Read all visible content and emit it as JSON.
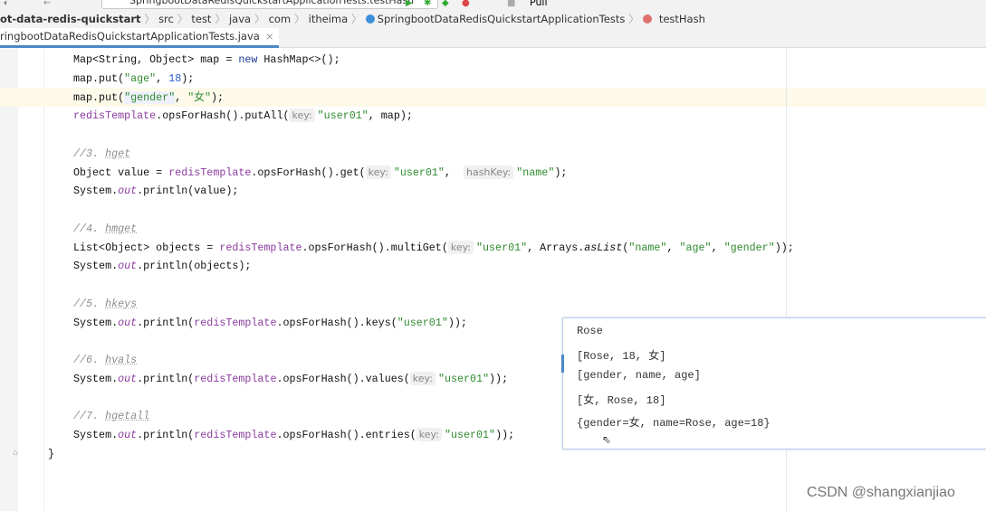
{
  "toolbar": {
    "run_config": "SpringbootDataRedisQuickstartApplicationTests.testHash",
    "right_label": "Pull"
  },
  "breadcrumb": [
    {
      "label": "ot-data-redis-quickstart",
      "bold": true
    },
    {
      "label": "src"
    },
    {
      "label": "test"
    },
    {
      "label": "java"
    },
    {
      "label": "com"
    },
    {
      "label": "itheima"
    },
    {
      "label": "SpringbootDataRedisQuickstartApplicationTests",
      "icon": "class-icon"
    },
    {
      "label": "testHash",
      "icon": "method-icon"
    }
  ],
  "tab": {
    "label": "ringbootDataRedisQuickstartApplicationTests.java",
    "close": "×"
  },
  "code": {
    "lines": [
      {
        "tokens": [
          {
            "t": "Map<String, Object> map = "
          },
          {
            "t": "new",
            "c": "k"
          },
          {
            "t": " HashMap<>();"
          }
        ]
      },
      {
        "tokens": [
          {
            "t": "map.put("
          },
          {
            "t": "\"age\"",
            "c": "s"
          },
          {
            "t": ", "
          },
          {
            "t": "18",
            "c": "n"
          },
          {
            "t": ");"
          }
        ]
      },
      {
        "tokens": [
          {
            "t": "map.put("
          },
          {
            "t": "\"gender\"",
            "c": "s hl"
          },
          {
            "t": ", "
          },
          {
            "t": "\"女\"",
            "c": "s"
          },
          {
            "t": ");"
          }
        ]
      },
      {
        "tokens": [
          {
            "t": "redisTemplate",
            "c": "f"
          },
          {
            "t": ".opsForHash().putAll("
          },
          {
            "t": "key:",
            "c": "h"
          },
          {
            "t": "\"user01\"",
            "c": "s"
          },
          {
            "t": ", map);"
          }
        ]
      },
      {
        "tokens": []
      },
      {
        "tokens": [
          {
            "t": "//3. ",
            "c": "c"
          },
          {
            "t": "hget",
            "c": "cu"
          }
        ]
      },
      {
        "tokens": [
          {
            "t": "Object value = "
          },
          {
            "t": "redisTemplate",
            "c": "f"
          },
          {
            "t": ".opsForHash().get("
          },
          {
            "t": "key:",
            "c": "h"
          },
          {
            "t": "\"user01\"",
            "c": "s"
          },
          {
            "t": ",  "
          },
          {
            "t": "hashKey:",
            "c": "h"
          },
          {
            "t": "\"name\"",
            "c": "s"
          },
          {
            "t": ");"
          }
        ]
      },
      {
        "tokens": [
          {
            "t": "System."
          },
          {
            "t": "out",
            "c": "fi"
          },
          {
            "t": ".println(value);"
          }
        ]
      },
      {
        "tokens": []
      },
      {
        "tokens": [
          {
            "t": "//4. ",
            "c": "c"
          },
          {
            "t": "hmget",
            "c": "cu"
          }
        ]
      },
      {
        "tokens": [
          {
            "t": "List<Object> objects = "
          },
          {
            "t": "redisTemplate",
            "c": "f"
          },
          {
            "t": ".opsForHash().multiGet("
          },
          {
            "t": "key:",
            "c": "h"
          },
          {
            "t": "\"user01\"",
            "c": "s"
          },
          {
            "t": ", Arrays."
          },
          {
            "t": "asList",
            "c": "m"
          },
          {
            "t": "("
          },
          {
            "t": "\"name\"",
            "c": "s"
          },
          {
            "t": ", "
          },
          {
            "t": "\"age\"",
            "c": "s"
          },
          {
            "t": ", "
          },
          {
            "t": "\"gender\"",
            "c": "s"
          },
          {
            "t": "));"
          }
        ]
      },
      {
        "tokens": [
          {
            "t": "System."
          },
          {
            "t": "out",
            "c": "fi"
          },
          {
            "t": ".println(objects);"
          }
        ]
      },
      {
        "tokens": []
      },
      {
        "tokens": [
          {
            "t": "//5. ",
            "c": "c"
          },
          {
            "t": "hkeys",
            "c": "cu"
          }
        ]
      },
      {
        "tokens": [
          {
            "t": "System."
          },
          {
            "t": "out",
            "c": "fi"
          },
          {
            "t": ".println("
          },
          {
            "t": "redisTemplate",
            "c": "f"
          },
          {
            "t": ".opsForHash().keys("
          },
          {
            "t": "\"user01\"",
            "c": "s"
          },
          {
            "t": "));"
          }
        ]
      },
      {
        "tokens": []
      },
      {
        "tokens": [
          {
            "t": "//6. ",
            "c": "c"
          },
          {
            "t": "hvals",
            "c": "cu"
          }
        ]
      },
      {
        "tokens": [
          {
            "t": "System."
          },
          {
            "t": "out",
            "c": "fi"
          },
          {
            "t": ".println("
          },
          {
            "t": "redisTemplate",
            "c": "f"
          },
          {
            "t": ".opsForHash().values("
          },
          {
            "t": "key:",
            "c": "h"
          },
          {
            "t": "\"user01\"",
            "c": "s"
          },
          {
            "t": "));"
          }
        ]
      },
      {
        "tokens": []
      },
      {
        "tokens": [
          {
            "t": "//7. ",
            "c": "c"
          },
          {
            "t": "hgetall",
            "c": "cu"
          }
        ]
      },
      {
        "tokens": [
          {
            "t": "System."
          },
          {
            "t": "out",
            "c": "fi"
          },
          {
            "t": ".println("
          },
          {
            "t": "redisTemplate",
            "c": "f"
          },
          {
            "t": ".opsForHash().entries("
          },
          {
            "t": "key:",
            "c": "h"
          },
          {
            "t": "\"user01\"",
            "c": "s"
          },
          {
            "t": "));"
          }
        ]
      },
      {
        "tokens": [
          {
            "t": "}"
          }
        ],
        "indent": "outer"
      }
    ]
  },
  "output": [
    "Rose",
    "[Rose, 18, 女]",
    "[gender, name, age]",
    "[女, Rose, 18]",
    "{gender=女, name=Rose, age=18}"
  ],
  "watermark": "CSDN @shangxianjiao",
  "colors": {
    "accent": "#4a88c7",
    "string": "#2f8a2f",
    "keyword": "#1f3a93",
    "field": "#8b3b9e",
    "comment": "#8c8c8c"
  }
}
